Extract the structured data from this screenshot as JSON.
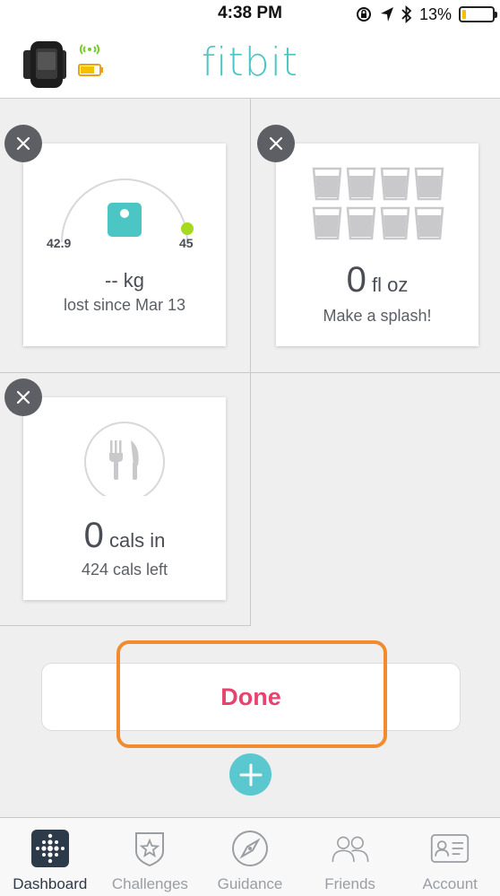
{
  "status_bar": {
    "time": "4:38 PM",
    "battery_percent": "13%",
    "battery_level": 0.13
  },
  "header": {
    "logo": "fitbit"
  },
  "tiles": {
    "weight": {
      "start": "42.9",
      "goal": "45",
      "value": "-- kg",
      "subtitle": "lost since Mar 13"
    },
    "water": {
      "value": "0",
      "unit": "fl oz",
      "subtitle": "Make a splash!"
    },
    "food": {
      "value": "0",
      "unit": "cals in",
      "subtitle": "424 cals left"
    }
  },
  "done_label": "Done",
  "tabs": [
    {
      "label": "Dashboard",
      "icon": "dashboard-icon",
      "active": true
    },
    {
      "label": "Challenges",
      "icon": "challenges-icon",
      "active": false
    },
    {
      "label": "Guidance",
      "icon": "compass-icon",
      "active": false
    },
    {
      "label": "Friends",
      "icon": "friends-icon",
      "active": false
    },
    {
      "label": "Account",
      "icon": "account-icon",
      "active": false
    }
  ],
  "colors": {
    "brand_teal": "#4cc6c4",
    "done_pink": "#e8436e",
    "highlight_orange": "#f28a2e",
    "goal_green": "#a7d91e"
  }
}
